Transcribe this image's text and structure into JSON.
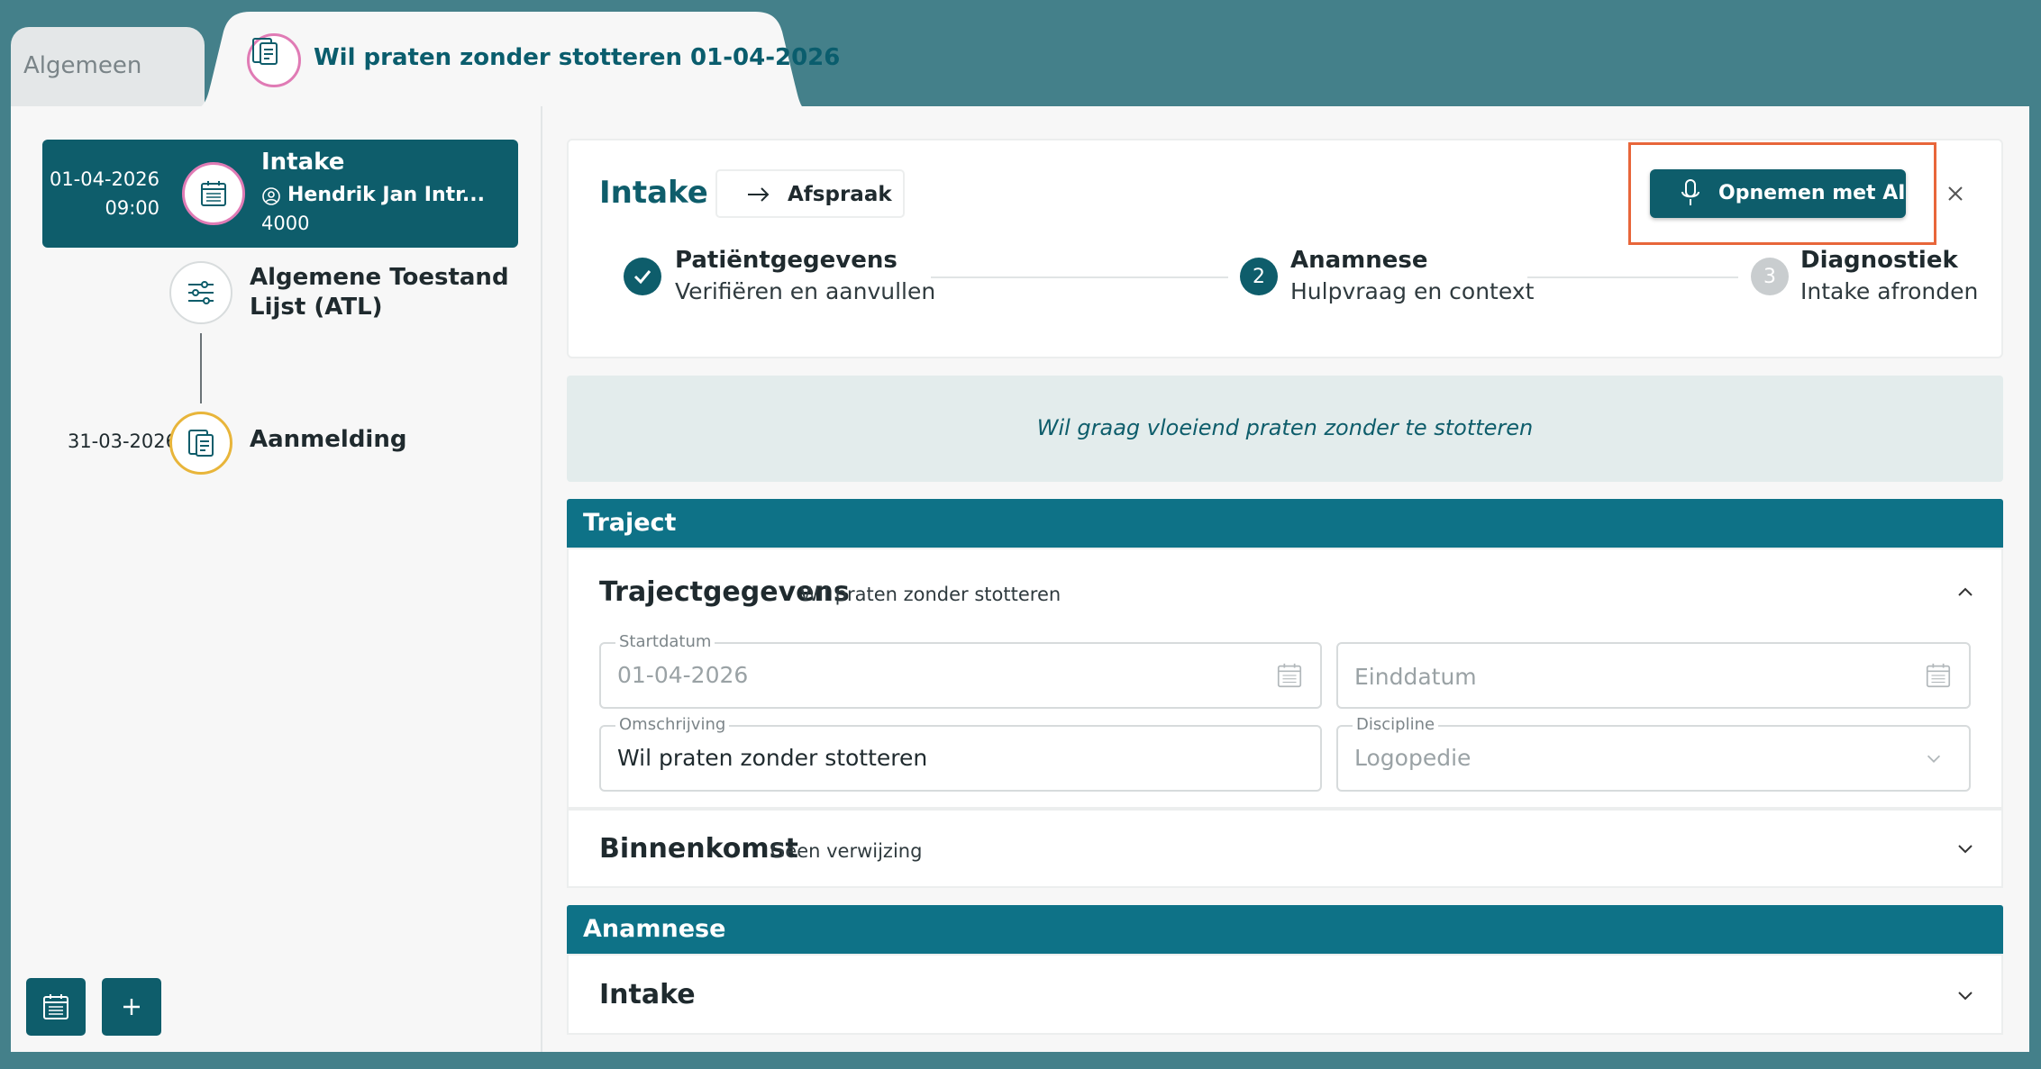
{
  "tabs": {
    "inactive_label": "Algemeen",
    "active_label": "Wil praten zonder stotteren  01-04-2026"
  },
  "sidebar": {
    "items": [
      {
        "date": "01-04-2026",
        "time": "09:00",
        "title": "Intake",
        "person": "Hendrik Jan Intr...",
        "code": "4000",
        "icon": "calendar-icon"
      },
      {
        "title_line1": "Algemene Toestand",
        "title_line2": "Lijst (ATL)",
        "icon": "sliders-icon"
      },
      {
        "date": "31-03-2026",
        "title": "Aanmelding",
        "icon": "document-icon"
      }
    ]
  },
  "header": {
    "title": "Intake",
    "appointment_button": "Afspraak",
    "record_button": "Opnemen met AI"
  },
  "steps": [
    {
      "title": "Patiëntgegevens",
      "subtitle": "Verifiëren en aanvullen",
      "state": "done"
    },
    {
      "number": "2",
      "title": "Anamnese",
      "subtitle": "Hulpvraag en context",
      "state": "active"
    },
    {
      "number": "3",
      "title": "Diagnostiek",
      "subtitle": "Intake afronden",
      "state": "pending"
    }
  ],
  "goal_banner": "Wil graag vloeiend praten zonder te stotteren",
  "traject": {
    "header": "Traject",
    "trajectgegevens_title": "Trajectgegevens",
    "trajectgegevens_subtitle": "Wil praten zonder stotteren",
    "fields": {
      "startdatum_label": "Startdatum",
      "startdatum_value": "01-04-2026",
      "einddatum_placeholder": "Einddatum",
      "omschrijving_label": "Omschrijving",
      "omschrijving_value": "Wil praten zonder stotteren",
      "discipline_label": "Discipline",
      "discipline_value": "Logopedie"
    },
    "binnenkomst_title": "Binnenkomst",
    "binnenkomst_subtitle": "Geen verwijzing"
  },
  "anamnese": {
    "header": "Anamnese",
    "intake_title": "Intake"
  },
  "colors": {
    "brand_dark": "#0e5d6b",
    "section_header": "#0e7287",
    "highlight": "#e8663a",
    "page_bg": "#44808a"
  }
}
